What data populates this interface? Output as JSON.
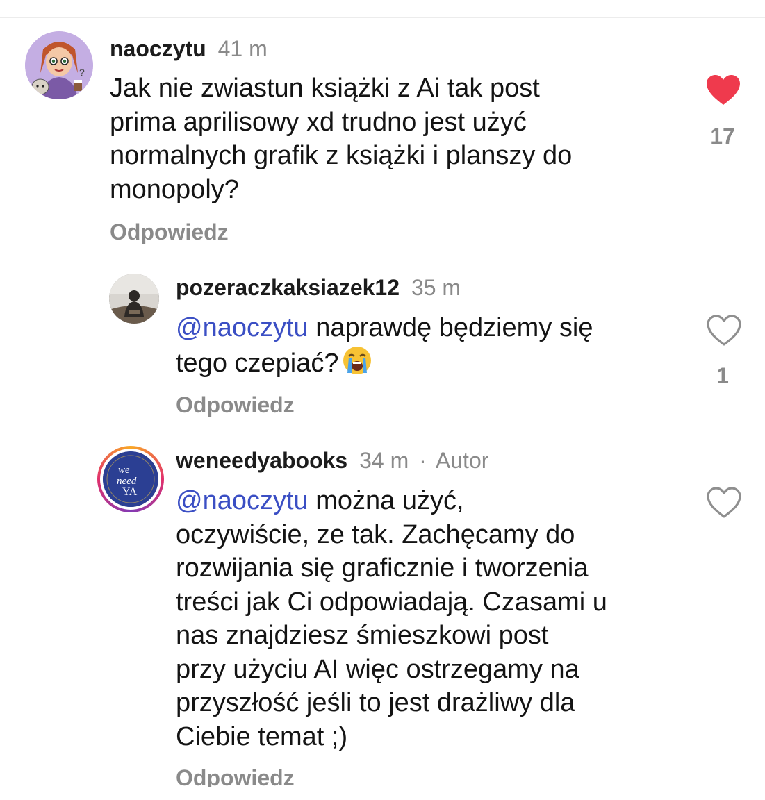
{
  "comments": [
    {
      "username": "naoczytu",
      "time": "41 m",
      "text_lines": [
        "Jak nie zwiastun książki z Ai tak post",
        "prima aprilisowy xd trudno jest  użyć",
        "normalnych  grafik z książki i planszy do",
        "monopoly?"
      ],
      "reply_label": "Odpowiedz",
      "liked": true,
      "like_count": "17"
    },
    {
      "username": "pozeraczkaksiazek12",
      "time": "35 m",
      "mention": "@naoczytu",
      "text_lines": [
        " naprawdę będziemy się",
        "tego czepiać?"
      ],
      "emoji": "loudly-crying-face",
      "reply_label": "Odpowiedz",
      "liked": false,
      "like_count": "1"
    },
    {
      "username": "weneedyabooks",
      "time": "34 m",
      "separator": "·",
      "author_label": "Autor",
      "mention": "@naoczytu",
      "text_lines": [
        " można użyć,",
        "oczywiście, ze tak. Zachęcamy do",
        "rozwijania się graficznie i tworzenia",
        "treści jak Ci odpowiadają. Czasami u",
        "nas znajdziesz śmieszkowi post",
        "przy użyciu AI więc ostrzegamy na",
        "przyszłość jeśli to jest drażliwy dla",
        "Ciebie temat ;)"
      ],
      "reply_label": "Odpowiedz",
      "liked": false,
      "avatar_logo_text": [
        "we",
        "need",
        "YA"
      ]
    }
  ],
  "colors": {
    "liked_heart": "#ef3a4d",
    "mention": "#3b4fc4",
    "muted": "#8a8a8a",
    "story_ring": [
      "#f9a825",
      "#e1306c",
      "#833ab4"
    ]
  }
}
